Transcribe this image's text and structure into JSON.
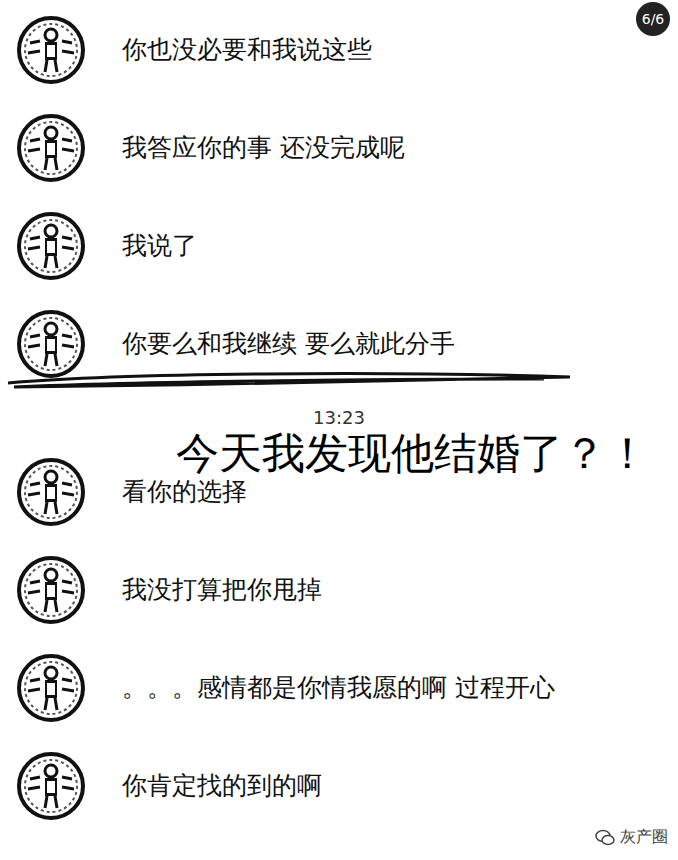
{
  "badge": "6/6",
  "chat": [
    {
      "kind": "message",
      "text": "你也没必要和我说这些",
      "underlined": false
    },
    {
      "kind": "message",
      "text": "我答应你的事 还没完成呢",
      "underlined": false
    },
    {
      "kind": "message",
      "text": "我说了",
      "underlined": false
    },
    {
      "kind": "message",
      "text": "你要么和我继续 要么就此分手",
      "underlined": true
    },
    {
      "kind": "time",
      "text": "13:23",
      "underlined": false
    },
    {
      "kind": "message",
      "text": "看你的选择",
      "underlined": false
    },
    {
      "kind": "message",
      "text": "我没打算把你甩掉",
      "underlined": false
    },
    {
      "kind": "message",
      "text": "。。。感情都是你情我愿的啊 过程开心",
      "underlined": false
    },
    {
      "kind": "message",
      "text": "你肯定找的到的啊",
      "underlined": false
    }
  ],
  "overlay": "今天我发现他结婚了？！",
  "watermark": "灰产圈"
}
